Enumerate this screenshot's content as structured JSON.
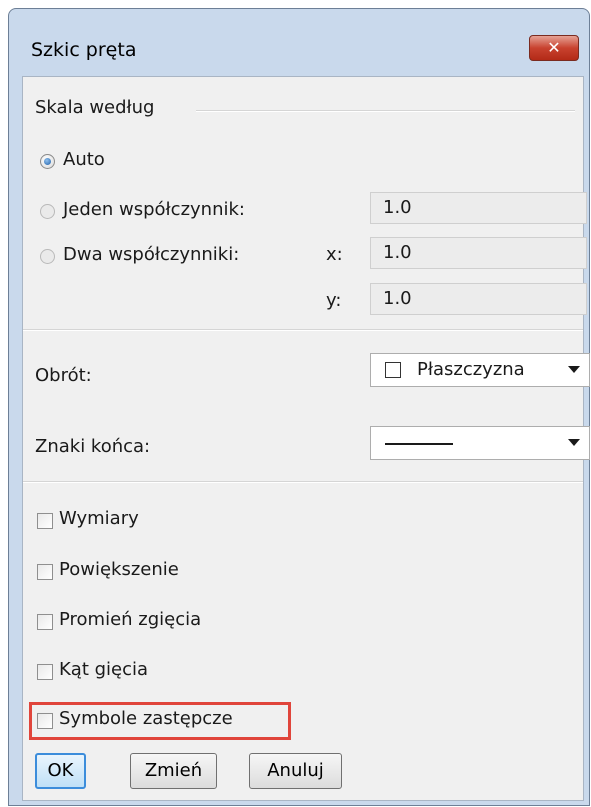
{
  "window": {
    "title": "Szkic pręta",
    "close_label": "✕"
  },
  "scale_group": {
    "title": "Skala według",
    "auto_label": "Auto",
    "single_label": "Jeden współczynnik:",
    "single_value": "1.0",
    "double_label": "Dwa współczynniki:",
    "x_label": "x:",
    "x_value": "1.0",
    "y_label": "y:",
    "y_value": "1.0",
    "selected": "Auto"
  },
  "rotation": {
    "label": "Obrót:",
    "value": "Płaszczyzna"
  },
  "end_marks": {
    "label": "Znaki końca:",
    "value_icon": "solid-line"
  },
  "options": [
    {
      "label": "Wymiary",
      "checked": false
    },
    {
      "label": "Powiększenie",
      "checked": false
    },
    {
      "label": "Promień zgięcia",
      "checked": false
    },
    {
      "label": "Kąt gięcia",
      "checked": false
    },
    {
      "label": "Symbole zastępcze",
      "checked": false
    }
  ],
  "buttons": {
    "ok": "OK",
    "change": "Zmień",
    "cancel": "Anuluj"
  },
  "colors": {
    "accent": "#3c8ddb",
    "highlight": "#e0453b",
    "close": "#c8422f"
  }
}
